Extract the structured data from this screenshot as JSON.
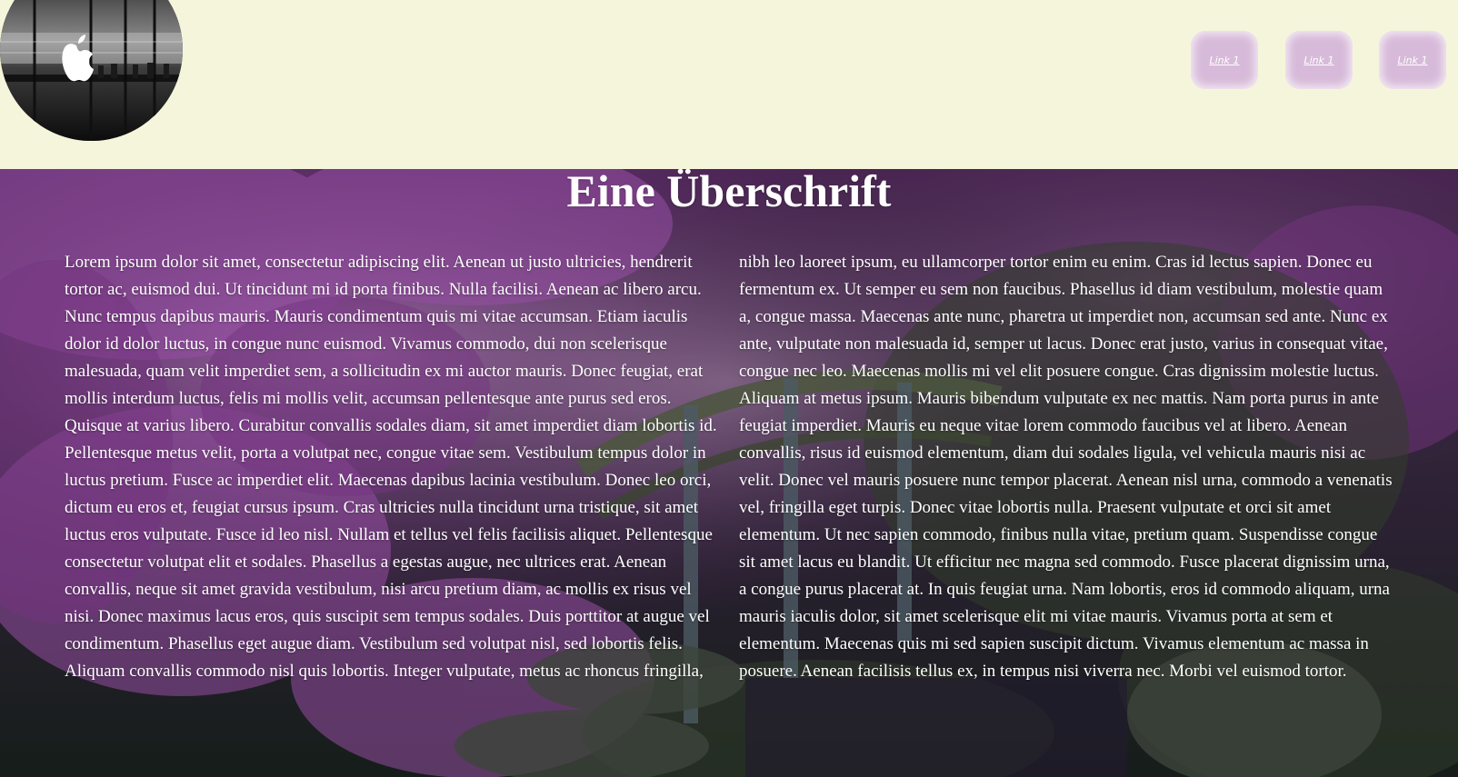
{
  "nav": {
    "links": [
      "Link 1",
      "Link 1",
      "Link 1"
    ]
  },
  "main": {
    "heading": "Eine Überschrift",
    "body": "Lorem ipsum dolor sit amet, consectetur adipiscing elit. Aenean ut justo ultricies, hendrerit tortor ac, euismod dui. Ut tincidunt mi id porta finibus. Nulla facilisi. Aenean ac libero arcu. Nunc tempus dapibus mauris. Mauris condimentum quis mi vitae accumsan. Etiam iaculis dolor id dolor luctus, in congue nunc euismod. Vivamus commodo, dui non scelerisque malesuada, quam velit imperdiet sem, a sollicitudin ex mi auctor mauris. Donec feugiat, erat mollis interdum luctus, felis mi mollis velit, accumsan pellentesque ante purus sed eros. Quisque at varius libero. Curabitur convallis sodales diam, sit amet imperdiet diam lobortis id. Pellentesque metus velit, porta a volutpat nec, congue vitae sem. Vestibulum tempus dolor in luctus pretium. Fusce ac imperdiet elit. Maecenas dapibus lacinia vestibulum. Donec leo orci, dictum eu eros et, feugiat cursus ipsum. Cras ultricies nulla tincidunt urna tristique, sit amet luctus eros vulputate. Fusce id leo nisl. Nullam et tellus vel felis facilisis aliquet. Pellentesque consectetur volutpat elit et sodales. Phasellus a egestas augue, nec ultrices erat. Aenean convallis, neque sit amet gravida vestibulum, nisi arcu pretium diam, ac mollis ex risus vel nisi. Donec maximus lacus eros, quis suscipit sem tempus sodales. Duis porttitor at augue vel condimentum. Phasellus eget augue diam. Vestibulum sed volutpat nisl, sed lobortis felis. Aliquam convallis commodo nisl quis lobortis. Integer vulputate, metus ac rhoncus fringilla, nibh leo laoreet ipsum, eu ullamcorper tortor enim eu enim. Cras id lectus sapien. Donec eu fermentum ex. Ut semper eu sem non faucibus. Phasellus id diam vestibulum, molestie quam a, congue massa. Maecenas ante nunc, pharetra ut imperdiet non, accumsan sed ante. Nunc ex ante, vulputate non malesuada id, semper ut lacus. Donec erat justo, varius in consequat vitae, congue nec leo. Maecenas mollis mi vel elit posuere congue. Cras dignissim molestie luctus. Aliquam at metus ipsum. Mauris bibendum vulputate ex nec mattis. Nam porta purus in ante feugiat imperdiet. Mauris eu neque vitae lorem commodo faucibus vel at libero. Aenean convallis, risus id euismod elementum, diam dui sodales ligula, vel vehicula mauris nisi ac velit. Donec vel mauris posuere nunc tempor placerat. Aenean nisl urna, commodo a venenatis vel, fringilla eget turpis. Donec vitae lobortis nulla. Praesent vulputate et orci sit amet elementum. Ut nec sapien commodo, finibus nulla vitae, pretium quam. Suspendisse congue sit amet lacus eu blandit. Ut efficitur nec magna sed commodo. Fusce placerat dignissim urna, a congue purus placerat at. In quis feugiat urna. Nam lobortis, eros id commodo aliquam, urna mauris iaculis dolor, sit amet scelerisque elit mi vitae mauris. Vivamus porta at sem et elementum. Maecenas quis mi sed sapien suscipit dictum. Vivamus elementum ac massa in posuere. Aenean facilisis tellus ex, in tempus nisi viverra nec. Morbi vel euismod tortor."
  },
  "colors": {
    "header_background": "#f5f5dc",
    "link_button": "#d7bad9",
    "text": "#ffffff"
  },
  "icons": {
    "logo": "apple-store-photo-logo",
    "background": "purple-garden-bridge-photo"
  }
}
